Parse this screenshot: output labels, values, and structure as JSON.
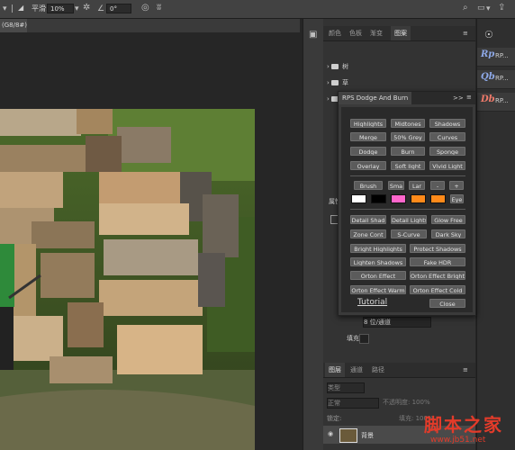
{
  "options_bar": {
    "flow_label": "平滑:",
    "flow_value": "10%",
    "angle_value": "0°"
  },
  "document": {
    "tab_label": "(G8/8#)"
  },
  "panels": {
    "top_tabs": [
      "颜色",
      "色板",
      "渐变",
      "图案"
    ],
    "list_items": [
      "树",
      "草",
      "水"
    ],
    "properties_label": "属性",
    "fill_label": "填充",
    "blend_mode": "8 位/通道",
    "bottom_tabs": [
      "图层",
      "通道",
      "路径"
    ],
    "layer_kind": "类型",
    "blend": "正常",
    "opacity": "不透明度: 100%",
    "lock_label": "锁定:",
    "fill_opacity": "填充: 100%",
    "layer_name": "背景"
  },
  "right_dock": {
    "items": [
      {
        "badge": "Rp",
        "label": "RP..."
      },
      {
        "badge": "Qb",
        "label": "RP..."
      },
      {
        "badge": "Db",
        "label": "RP..."
      }
    ]
  },
  "plugin": {
    "title": "RPS Dodge And Burn",
    "header_right": ">>",
    "group1": [
      [
        "Highlights",
        "Midtones",
        "Shadows"
      ],
      [
        "Merge",
        "50% Grey",
        "Curves"
      ],
      [
        "Dodge",
        "Burn",
        "Sponge"
      ],
      [
        "Overlay",
        "Soft light",
        "Vivid Light"
      ]
    ],
    "brush_row": [
      "Brush",
      "Sma",
      "Lar",
      "-",
      "+"
    ],
    "eye_label": "Eye",
    "swatches": [
      "#ffffff",
      "#000000",
      "#ff66cc",
      "#ff8a1a",
      "#ff8a1a"
    ],
    "group2": [
      [
        "Detail Shad",
        "Detail Lights",
        "Glow Free"
      ],
      [
        "Zone Cont",
        "S-Curve",
        "Dark Sky"
      ]
    ],
    "group3": [
      [
        "Bright Highlights",
        "Protect Shadows"
      ],
      [
        "Lighten Shadows",
        "Fake HDR"
      ],
      [
        "Orton Effect",
        "Orton Effect Bright"
      ],
      [
        "Orton Effect Warm",
        "Orton Effect Cold"
      ]
    ],
    "tutorial": "Tutorial",
    "close": "Close"
  },
  "watermark": {
    "title": "脚本之家",
    "url": "www.jb51.net"
  }
}
